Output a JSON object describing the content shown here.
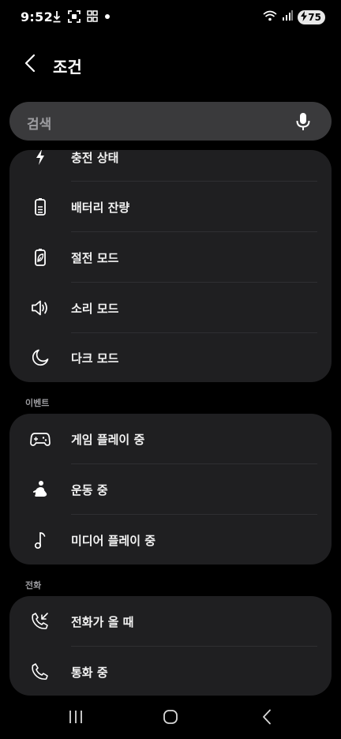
{
  "status_bar": {
    "time": "9:52",
    "battery_level": "75",
    "icons": [
      "download-icon",
      "screenshot-icon",
      "grid-icon",
      "dot-icon",
      "wifi-icon",
      "signal-icon",
      "charging-icon"
    ]
  },
  "header": {
    "title": "조건",
    "back_icon": "back-chevron-icon"
  },
  "search": {
    "placeholder": "검색",
    "mic_icon": "mic-icon"
  },
  "conditions": {
    "items": [
      {
        "label": "충전 상태",
        "icon": "lightning-icon"
      },
      {
        "label": "배터리 잔량",
        "icon": "battery-icon"
      },
      {
        "label": "절전 모드",
        "icon": "power-saving-icon"
      },
      {
        "label": "소리 모드",
        "icon": "speaker-icon"
      },
      {
        "label": "다크 모드",
        "icon": "moon-icon"
      }
    ]
  },
  "events": {
    "header": "이벤트",
    "items": [
      {
        "label": "게임 플레이 중",
        "icon": "gamepad-icon"
      },
      {
        "label": "운동 중",
        "icon": "exercise-icon"
      },
      {
        "label": "미디어 플레이 중",
        "icon": "music-note-icon"
      }
    ]
  },
  "calls": {
    "header": "전화",
    "items": [
      {
        "label": "전화가 올 때",
        "icon": "incoming-call-icon"
      },
      {
        "label": "통화 중",
        "icon": "phone-icon"
      }
    ]
  },
  "nav_bar": {
    "icons": [
      "recents-icon",
      "home-icon",
      "back-icon"
    ]
  },
  "colors": {
    "background": "#000000",
    "card": "#1f1f21",
    "search": "#3a3a3c",
    "secondary_text": "#9d9da1"
  }
}
